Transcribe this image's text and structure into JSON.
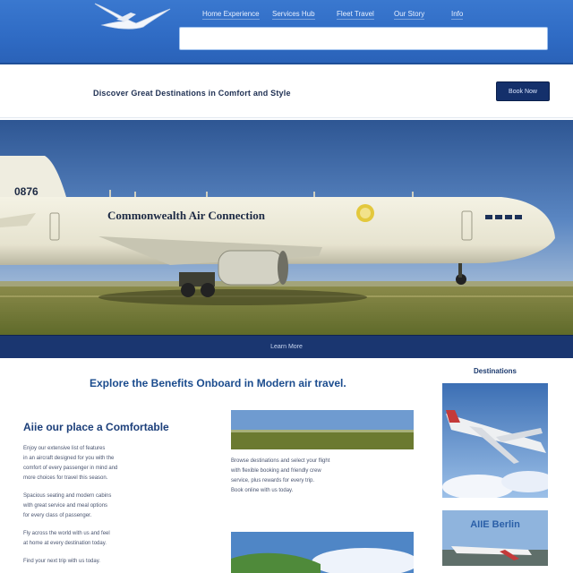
{
  "header": {
    "logo_icon": "airplane-logo-icon",
    "nav": [
      "Home Experience",
      "Services Hub",
      "Fleet Travel",
      "Our Story",
      "Info"
    ],
    "search_placeholder": ""
  },
  "banner": {
    "tagline": "Discover Great Destinations in Comfort and Style",
    "cta_label": "Book Now"
  },
  "hero": {
    "tail_number": "0876",
    "livery_text": "Commonwealth Air Connection",
    "caption": "Learn More"
  },
  "content": {
    "headline": "Explore the Benefits Onboard in Modern air travel.",
    "left_heading": "Aiie our place a Comfortable",
    "left_paragraphs": [
      [
        "Enjoy our extensive list of features",
        "in an aircraft designed for you with the",
        "comfort of every passenger in mind and",
        "more choices for travel this season."
      ],
      [
        "Spacious seating and modern cabins",
        "with great service and meal options",
        "for every class of passenger."
      ],
      [
        "Fly across the world with us and feel",
        "at home at every destination today."
      ],
      [
        "Find your next trip with us today."
      ]
    ],
    "mid_paragraph": [
      "Browse destinations and select your flight",
      "with flexible booking and friendly crew",
      "service, plus rewards for every trip.",
      "Book online with us today."
    ]
  },
  "sidebar": {
    "title": "Destinations",
    "card2_title": "AIIE Berlin"
  },
  "colors": {
    "header_blue": "#2f6bc4",
    "navy": "#14306b",
    "sky": "#3f6aa6",
    "grass": "#7d7a36"
  }
}
